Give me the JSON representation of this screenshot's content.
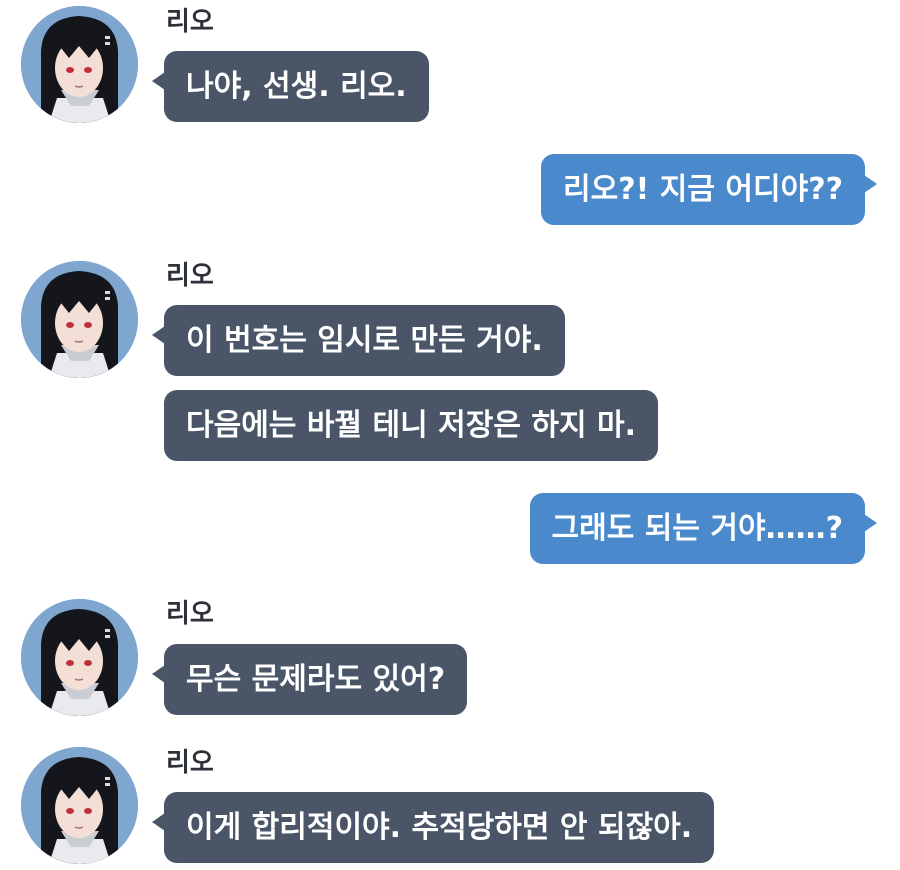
{
  "chat": {
    "sender_name": "리오",
    "colors": {
      "incoming_bubble": "#4a5568",
      "outgoing_bubble": "#4a89cc",
      "name_text": "#2d3138"
    },
    "messages": [
      {
        "from": "리오",
        "text": "나야, 선생. 리오."
      },
      {
        "from": "me",
        "text": "리오?! 지금 어디야??"
      },
      {
        "from": "리오",
        "text": "이 번호는 임시로 만든 거야."
      },
      {
        "from": "리오",
        "text": "다음에는 바꿜 테니 저장은 하지 마."
      },
      {
        "from": "me",
        "text": "그래도 되는 거야……?"
      },
      {
        "from": "리오",
        "text": "무슨 문제라도 있어?"
      },
      {
        "from": "리오",
        "text": "이게 합리적이야. 추적당하면 안 되잖아."
      }
    ],
    "avatar_icon": "rio-avatar-icon"
  }
}
